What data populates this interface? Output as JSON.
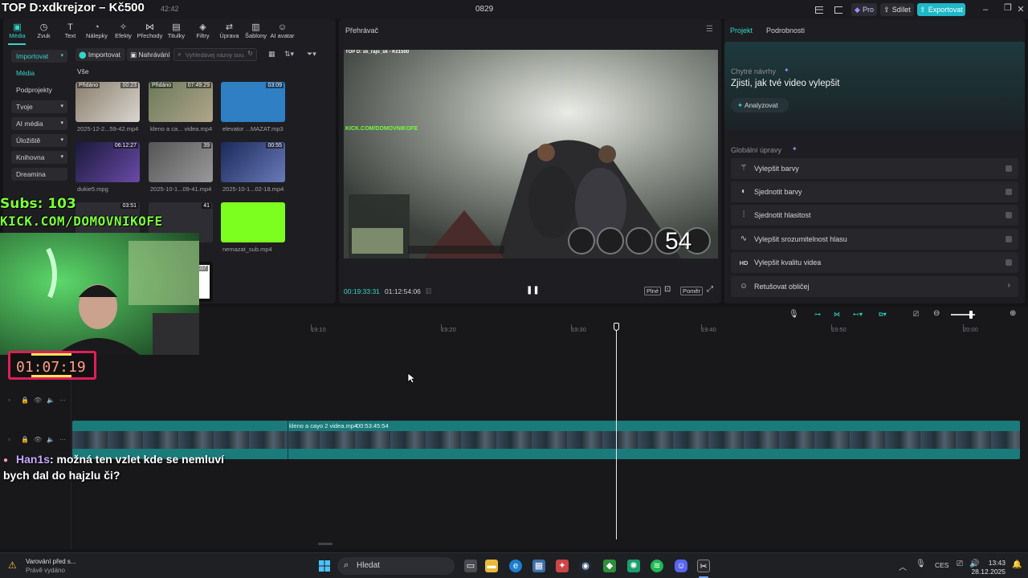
{
  "title_bar": {
    "stream_title": "TOP D:xdkrejzor – Kč500",
    "timecode": "42:42",
    "project_name": "0829",
    "pro_label": "Pro",
    "share_label": "Sdílet",
    "export_label": "Exportovat"
  },
  "media_toolbar": [
    {
      "label": "Média",
      "icon": "media-icon"
    },
    {
      "label": "Zvuk",
      "icon": "audio-icon"
    },
    {
      "label": "Text",
      "icon": "text-icon"
    },
    {
      "label": "Nálepky",
      "icon": "sticker-icon"
    },
    {
      "label": "Efekty",
      "icon": "effects-icon"
    },
    {
      "label": "Přechody",
      "icon": "transitions-icon"
    },
    {
      "label": "Titulky",
      "icon": "captions-icon"
    },
    {
      "label": "Filtry",
      "icon": "filters-icon"
    },
    {
      "label": "Úprava",
      "icon": "adjust-icon"
    },
    {
      "label": "Šablony",
      "icon": "templates-icon"
    },
    {
      "label": "AI avatar",
      "icon": "ai-avatar-icon"
    }
  ],
  "sidebar": {
    "items": [
      {
        "label": "Importovat",
        "has_chevron": true
      },
      {
        "label": "Média",
        "has_chevron": false
      },
      {
        "label": "Podprojekty",
        "has_chevron": false
      },
      {
        "label": "Tvoje",
        "has_chevron": true
      },
      {
        "label": "AI média",
        "has_chevron": true
      },
      {
        "label": "Úložiště",
        "has_chevron": true
      },
      {
        "label": "Knihovna",
        "has_chevron": true
      },
      {
        "label": "Dreamina",
        "has_chevron": false
      }
    ]
  },
  "media": {
    "import_label": "Importovat",
    "recordings_label": "Nahrávání",
    "search_placeholder": "Vyhledávej názvy sou...",
    "filter_all": "Vše",
    "added_badge": "Přidáno",
    "items": [
      {
        "name": "2025-12-2...59-42.mp4",
        "duration": "00:23",
        "added": true
      },
      {
        "name": "kleno a ca... videa.mp4",
        "duration": "07:49:29",
        "added": true
      },
      {
        "name": "elevator ...MAZAT.mp3",
        "duration": "03:09",
        "added": false
      },
      {
        "name": "dukie5.mpg",
        "duration": "06:12:27",
        "added": false
      },
      {
        "name": "2025-10-1...09-41.mp4",
        "duration": "39",
        "added": false
      },
      {
        "name": "2025-10-1...02-18.mp4",
        "duration": "00:55",
        "added": false
      },
      {
        "name": "",
        "duration": "03:51",
        "added": false
      },
      {
        "name": "",
        "duration": "41",
        "added": false
      },
      {
        "name": "nemazat_sub.mp4",
        "duration": "",
        "added": false
      },
      {
        "name": "",
        "duration": "03",
        "added": false
      },
      {
        "name": "",
        "duration": "00:07",
        "added": false
      }
    ]
  },
  "player": {
    "title": "Přehrávač",
    "current_time": "00:19:33:31",
    "total_time": "01:12:54:06",
    "full_label": "Plné",
    "ratio_label": "Poměr",
    "video_overlay_top": "TOP D: sk_rajo_sk - Kč1500",
    "video_overlay_kick": "KICK.COM/DOMOVNIKOFE",
    "video_speed": "54"
  },
  "props": {
    "tab_project": "Projekt",
    "tab_details": "Podrobnosti",
    "smart_title": "Chytré návrhy",
    "smart_subtitle": "Zjisti, jak tvé video vylepšit",
    "analyze_label": "Analyzovat",
    "global_title": "Globální úpravy",
    "rows": [
      {
        "label": "Vylepšit barvy",
        "icon": "wand-icon"
      },
      {
        "label": "Sjednotit barvy",
        "icon": "palette-icon"
      },
      {
        "label": "Sjednotit hlasitost",
        "icon": "sliders-icon"
      },
      {
        "label": "Vylepšit srozumitelnost hlasu",
        "icon": "waveform-icon"
      },
      {
        "label": "Vylepšit kvalitu videa",
        "icon": "hd-icon"
      },
      {
        "label": "Retušovat obličej",
        "icon": "face-icon"
      }
    ]
  },
  "timeline": {
    "ticks": [
      "19:10",
      "19:20",
      "19:30",
      "19:40",
      "19:50",
      "20:00"
    ],
    "clip_label": "kleno a cayo 2 videa.mp4",
    "clip_duration": "00:53:45:54"
  },
  "overlays": {
    "subs": "Subs: 103",
    "kick": "KICK.COM/DOMOVNIKOFE",
    "timer": "01:07:19",
    "chat_user": "Han1s",
    "chat_line1": ": možná ten vzlet kde se nemluví",
    "chat_line2": "bych dal do hajzlu či?"
  },
  "taskbar": {
    "notification_title": "Varování před s...",
    "notification_sub": "Právě vydáno",
    "search_label": "Hledat",
    "language": "CES",
    "time": "13:43",
    "date": "28.12.2025"
  },
  "colors": {
    "accent": "#33d6c8",
    "export": "#1fb8c9",
    "clip": "#1a7b7a",
    "overlay_green": "#7dff3a"
  }
}
